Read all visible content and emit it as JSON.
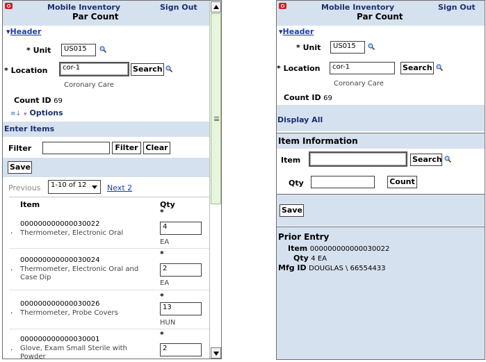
{
  "app": {
    "title": "Mobile Inventory",
    "signout": "Sign Out",
    "subtitle": "Par Count"
  },
  "colors": {
    "band": "#d6e1ef",
    "title": "#1a2f6e",
    "link": "#1a3fa8",
    "logo": "#d41f24"
  },
  "left": {
    "header_toggle": "▾",
    "header_label": "Header",
    "unit_label": "* Unit",
    "unit_value": "US015",
    "location_label": "* Location",
    "location_value": "cor-1",
    "search_label": "Search",
    "location_desc": "Coronary Care",
    "count_id_label": "Count ID",
    "count_id_value": "69",
    "options_label": "Options",
    "enter_items": "Enter Items",
    "filter_label": "Filter",
    "filter_value": "",
    "filter_button": "Filter",
    "clear_button": "Clear",
    "save_button": "Save",
    "pager": {
      "previous": "Previous",
      "range": "1-10 of 12",
      "next": "Next 2"
    },
    "table": {
      "col_item": "Item",
      "col_qty": "Qty",
      "rows": [
        {
          "bullet": "·",
          "code": "000000000000030022",
          "desc1": "Thermometer, Electronic Oral",
          "desc2": "",
          "req": "*",
          "qty": "4",
          "uom": "EA"
        },
        {
          "bullet": "·",
          "code": "000000000000030024",
          "desc1": "Thermometer, Electronic Oral and",
          "desc2": "Case Dip",
          "req": "*",
          "qty": "2",
          "uom": "EA"
        },
        {
          "bullet": "·",
          "code": "000000000000030026",
          "desc1": "Thermometer, Probe Covers",
          "desc2": "",
          "req": "*",
          "qty": "13",
          "uom": "HUN"
        },
        {
          "bullet": "·",
          "code": "000000000000030001",
          "desc1": "Glove, Exam Small Sterile with",
          "desc2": "Powder",
          "req": "*",
          "qty": "2",
          "uom": ""
        }
      ]
    }
  },
  "right": {
    "header_toggle": "▾",
    "header_label": "Header",
    "unit_label": "* Unit",
    "unit_value": "US015",
    "location_label": "* Location",
    "location_value": "cor-1",
    "search_label": "Search",
    "location_desc": "Coronary Care",
    "count_id_label": "Count ID",
    "count_id_value": "69",
    "display_all": "Display All",
    "item_info_title": "Item Information",
    "item_label": "Item",
    "item_value": "",
    "item_search": "Search",
    "qty_label": "Qty",
    "qty_value": "",
    "count_button": "Count",
    "save_button": "Save",
    "prior_entry_title": "Prior Entry",
    "prior_item_label": "Item",
    "prior_item_value": "000000000000030022",
    "prior_qty_label": "Qty",
    "prior_qty_value": "4 EA",
    "prior_mfg_label": "Mfg ID",
    "prior_mfg_value": "DOUGLAS \\ 66554433"
  }
}
